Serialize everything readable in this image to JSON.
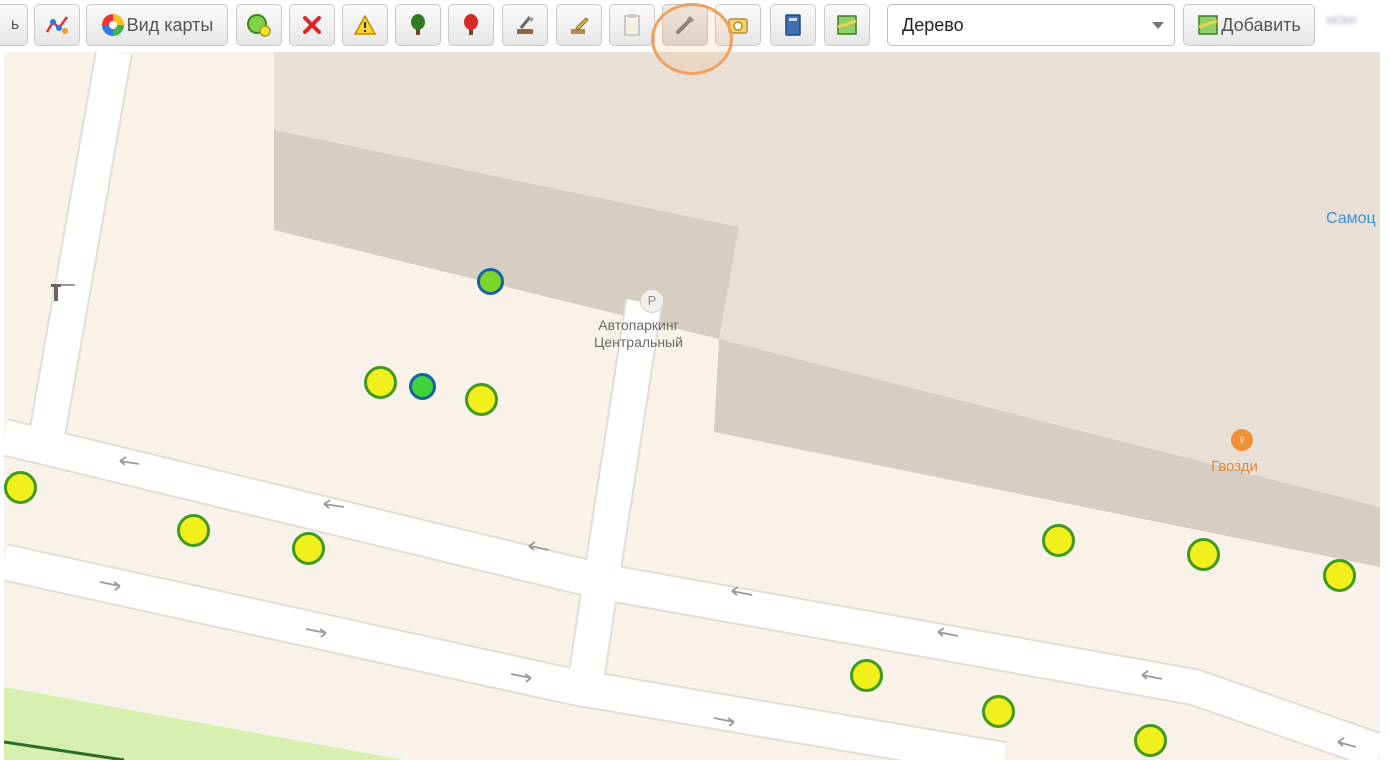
{
  "toolbar": {
    "partial_label": "ь",
    "route_icon": "route-icon",
    "map_view_label": "Вид карты",
    "buttons": [
      {
        "name": "add-zone-button",
        "icon": "green-circle-plus-icon"
      },
      {
        "name": "delete-button",
        "icon": "red-cross-icon"
      },
      {
        "name": "warning-button",
        "icon": "warning-triangle-icon"
      },
      {
        "name": "green-tree-button",
        "icon": "green-tree-icon"
      },
      {
        "name": "red-tree-button",
        "icon": "red-tree-icon"
      },
      {
        "name": "cut-tree-button",
        "icon": "axe-tree-icon"
      },
      {
        "name": "edit-tree-button",
        "icon": "pencil-tree-icon"
      },
      {
        "name": "clipboard-button",
        "icon": "clipboard-icon"
      },
      {
        "name": "dropper-button",
        "icon": "eyedropper-icon"
      },
      {
        "name": "photo-button",
        "icon": "camera-icon"
      },
      {
        "name": "book-button",
        "icon": "book-icon"
      },
      {
        "name": "map-add-button",
        "icon": "map-icon"
      }
    ],
    "select_value": "Дерево",
    "add_label": "Добавить",
    "user_label": "victor"
  },
  "map": {
    "labels": {
      "parking_symbol": "P",
      "parking_line1": "Автопаркинг",
      "parking_line2": "Центральный",
      "cafe": "Гвозди",
      "partial_poi": "Самоц"
    },
    "colors": {
      "tree_fill": "#f2f01c",
      "tree_border": "#3f9a1f",
      "selected_border": "#1d5fa5",
      "selected_fill": "#7bd62b",
      "highlight": "#f0a060"
    }
  }
}
